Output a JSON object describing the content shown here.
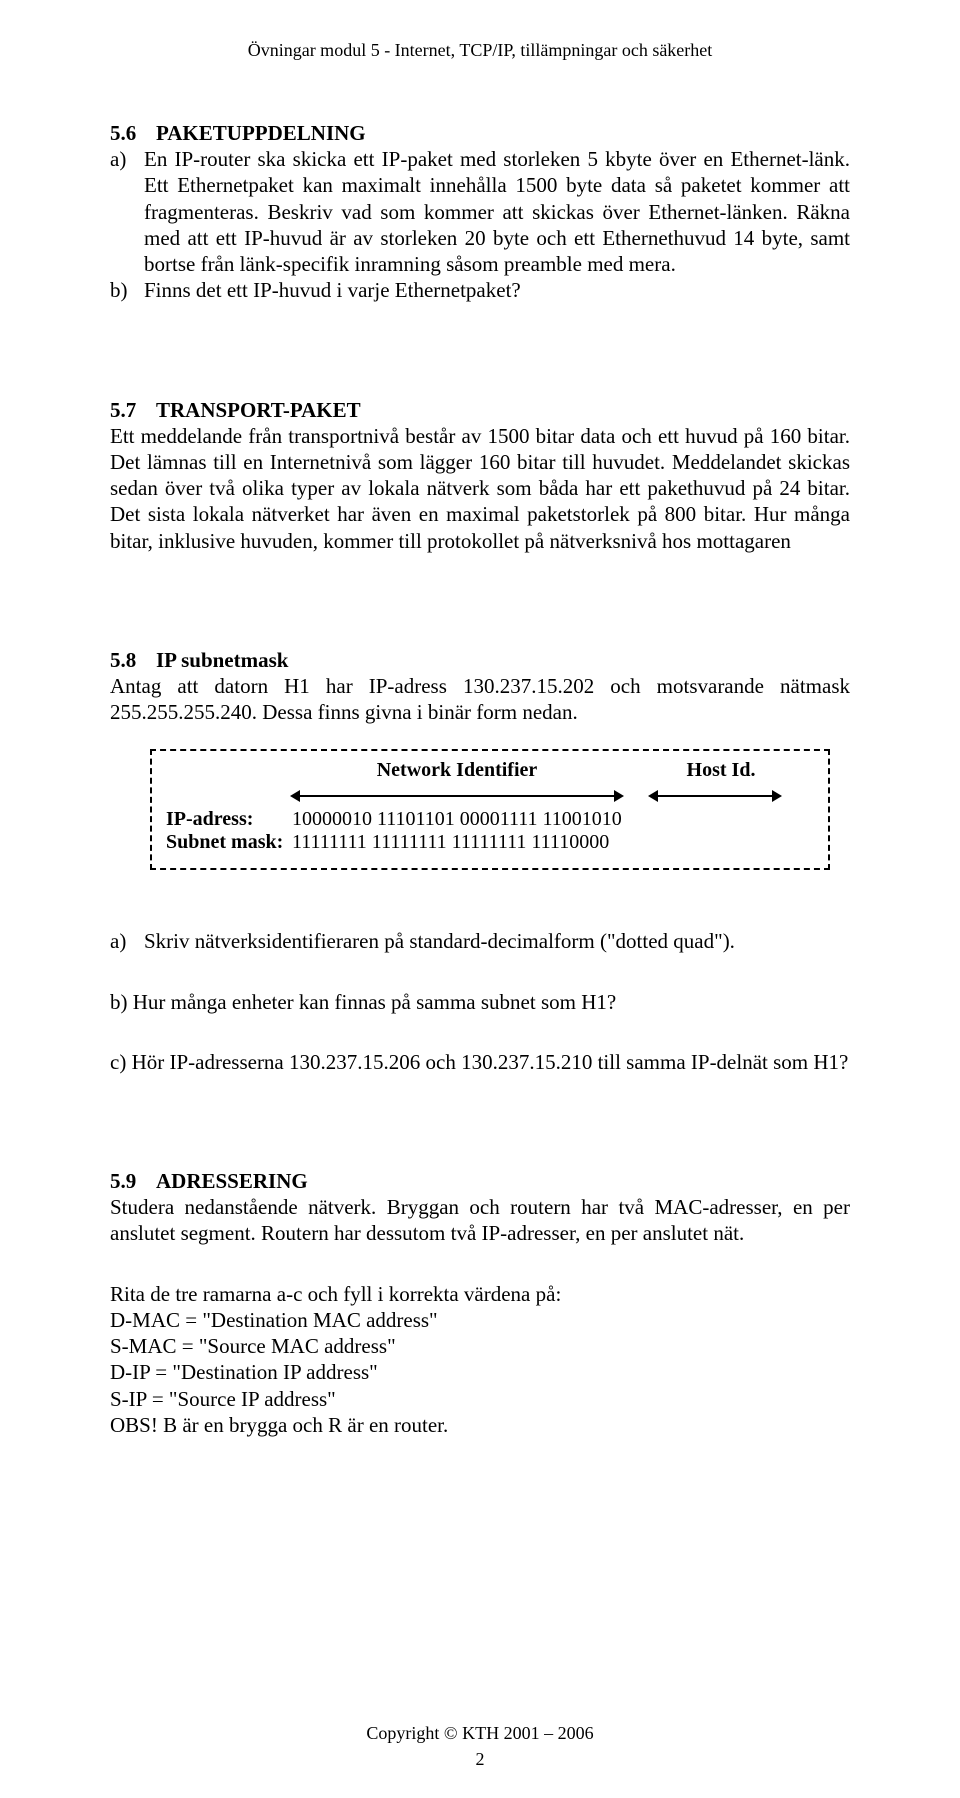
{
  "header": "Övningar modul 5 - Internet, TCP/IP, tillämpningar och säkerhet",
  "sec56": {
    "num": "5.6",
    "title": "PAKETUPPDELNING",
    "a_label": "a)",
    "a_text": "En IP-router ska skicka ett IP-paket med storleken 5 kbyte över en Ethernet-länk. Ett Ethernetpaket kan maximalt innehålla 1500 byte data så paketet kommer att fragmenteras. Beskriv vad som kommer att skickas över Ethernet-länken. Räkna med att ett IP-huvud är av storleken 20 byte och ett Ethernethuvud 14 byte, samt bortse från länk-specifik inramning såsom preamble med mera.",
    "b_label": "b)",
    "b_text": "Finns det ett IP-huvud i varje Ethernetpaket?"
  },
  "sec57": {
    "num": "5.7",
    "title": "TRANSPORT-PAKET",
    "text": "Ett meddelande från transportnivå består av 1500 bitar data och ett huvud på 160 bitar. Det lämnas till en Internetnivå som lägger 160 bitar till huvudet. Meddelandet skickas sedan över två olika typer av lokala nätverk som båda har ett pakethuvud på 24 bitar. Det sista lokala nätverket har även en maximal paketstorlek på 800 bitar. Hur många bitar, inklusive huvuden, kommer till protokollet på nätverksnivå hos mottagaren"
  },
  "sec58": {
    "num": "5.8",
    "title": "IP subnetmask",
    "intro": "Antag att datorn H1 har IP-adress 130.237.15.202 och motsvarande nätmask 255.255.255.240. Dessa finns givna i binär form nedan.",
    "diagram": {
      "net_label": "Network Identifier",
      "host_label": "Host Id.",
      "ip_label": "IP-adress:",
      "ip_bits": "10000010 11101101 00001111 11001010",
      "mask_label": "Subnet mask:",
      "mask_bits": "11111111 11111111 11111111 11110000"
    },
    "a_label": "a)",
    "a_text": "Skriv nätverksidentifieraren på standard-decimalform (\"dotted quad\").",
    "b_text": "b) Hur många enheter kan finnas på samma subnet som H1?",
    "c_text": "c) Hör IP-adresserna 130.237.15.206 och 130.237.15.210 till samma IP-delnät som H1?"
  },
  "sec59": {
    "num": "5.9",
    "title": "ADRESSERING",
    "p1": "Studera nedanstående nätverk. Bryggan och routern har två MAC-adresser, en per anslutet segment. Routern har dessutom två IP-adresser, en per anslutet nät.",
    "p2": "Rita de tre ramarna a-c och fyll i korrekta värdena på:",
    "l1": "D-MAC = \"Destination MAC address\"",
    "l2": "S-MAC = \"Source MAC address\"",
    "l3": "D-IP = \"Destination IP address\"",
    "l4": "S-IP = \"Source IP address\"",
    "obs": "OBS! B är en brygga och R är en router."
  },
  "footer": "Copyright © KTH 2001 – 2006",
  "page_number": "2"
}
